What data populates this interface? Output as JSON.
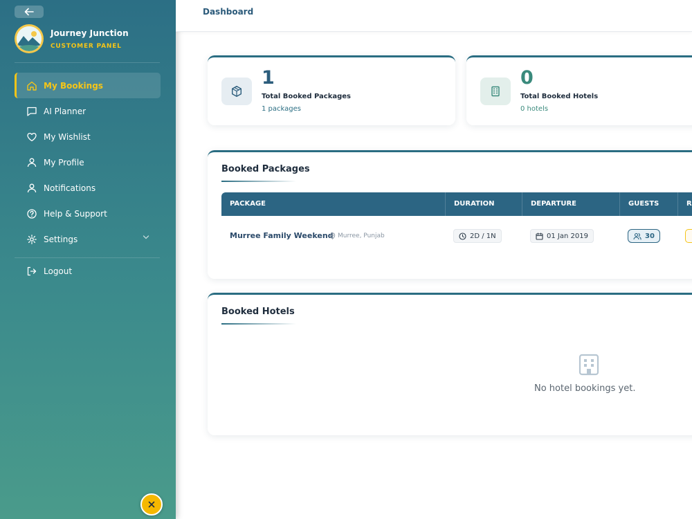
{
  "sidebar": {
    "brand_name": "Journey Junction",
    "brand_sub": "CUSTOMER PANEL",
    "items": [
      {
        "label": "My Bookings",
        "icon": "home-icon",
        "active": true
      },
      {
        "label": "AI Planner",
        "icon": "chat-icon"
      },
      {
        "label": "My Wishlist",
        "icon": "heart-icon"
      },
      {
        "label": "My Profile",
        "icon": "user-icon"
      },
      {
        "label": "Notifications",
        "icon": "user-icon"
      },
      {
        "label": "Help & Support",
        "icon": "help-icon"
      },
      {
        "label": "Settings",
        "icon": "gear-icon"
      }
    ],
    "logout_label": "Logout"
  },
  "header": {
    "title": "Dashboard"
  },
  "stats": {
    "packages": {
      "value": "1",
      "label": "Total Booked Packages",
      "sub": "1 packages",
      "icon": "package-icon"
    },
    "hotels": {
      "value": "0",
      "label": "Total Booked Hotels",
      "sub": "0 hotels",
      "icon": "building-icon"
    }
  },
  "booked_packages": {
    "title": "Booked Packages",
    "columns": [
      "PACKAGE",
      "DURATION",
      "DEPARTURE",
      "GUESTS",
      "R"
    ],
    "rows": [
      {
        "name": "Murree Family Weekend",
        "location": "Murree, Punjab",
        "duration": "2D / 1N",
        "departure": "01 Jan 2019",
        "guests": "30"
      }
    ]
  },
  "booked_hotels": {
    "title": "Booked Hotels",
    "empty_text": "No hotel bookings yet."
  },
  "colors": {
    "sidebar_top": "#2c6f85",
    "sidebar_bottom": "#4a9b8b",
    "accent": "#f5c518",
    "table_header": "#2c6583"
  }
}
